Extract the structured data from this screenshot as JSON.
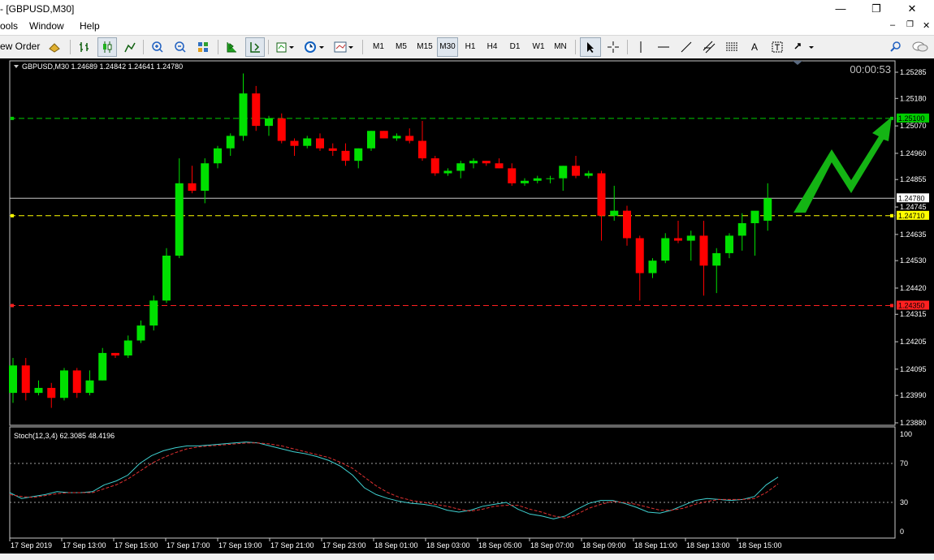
{
  "window": {
    "title": "- [GBPUSD,M30]",
    "controls": [
      "minimize-icon",
      "restore-icon",
      "close-icon"
    ]
  },
  "menu": {
    "items": [
      "ools",
      "Window",
      "Help"
    ],
    "mdi_controls": [
      "minimize-icon",
      "restore-icon",
      "close-icon"
    ]
  },
  "toolbar": {
    "new_order_label": "ew Order",
    "timeframes": [
      "M1",
      "M5",
      "M15",
      "M30",
      "H1",
      "H4",
      "D1",
      "W1",
      "MN"
    ],
    "selected_timeframe": "M30"
  },
  "chart": {
    "header": "GBPUSD,M30  1.24689 1.24842 1.24641 1.24780",
    "timer": "00:00:53",
    "stoch_header": "Stoch(12,3,4) 62.3085 48.4196"
  },
  "chart_data": [
    {
      "type": "candlestick",
      "symbol": "GBPUSD",
      "timeframe": "M30",
      "ylim": [
        1.2388,
        1.25285
      ],
      "yticks": [
        "1.25285",
        "1.25180",
        "1.25070",
        "1.24960",
        "1.24855",
        "1.24745",
        "1.24635",
        "1.24530",
        "1.24420",
        "1.24315",
        "1.24205",
        "1.24095",
        "1.23990",
        "1.23880"
      ],
      "xticks": [
        "17 Sep 2019",
        "17 Sep 13:00",
        "17 Sep 15:00",
        "17 Sep 17:00",
        "17 Sep 19:00",
        "17 Sep 21:00",
        "17 Sep 23:00",
        "18 Sep 01:00",
        "18 Sep 03:00",
        "18 Sep 05:00",
        "18 Sep 07:00",
        "18 Sep 09:00",
        "18 Sep 11:00",
        "18 Sep 13:00",
        "18 Sep 15:00"
      ],
      "bull_color": "#00e000",
      "bear_color": "#ff0000",
      "candles": [
        {
          "o": 1.24,
          "h": 1.2414,
          "l": 1.2396,
          "c": 1.2411
        },
        {
          "o": 1.2411,
          "h": 1.2414,
          "l": 1.2397,
          "c": 1.24
        },
        {
          "o": 1.24,
          "h": 1.2405,
          "l": 1.2399,
          "c": 1.2402
        },
        {
          "o": 1.2402,
          "h": 1.2404,
          "l": 1.2394,
          "c": 1.2398
        },
        {
          "o": 1.2398,
          "h": 1.241,
          "l": 1.2397,
          "c": 1.2409
        },
        {
          "o": 1.2409,
          "h": 1.241,
          "l": 1.2398,
          "c": 1.24
        },
        {
          "o": 1.24,
          "h": 1.2409,
          "l": 1.2399,
          "c": 1.2405
        },
        {
          "o": 1.2405,
          "h": 1.2418,
          "l": 1.2405,
          "c": 1.2416
        },
        {
          "o": 1.2416,
          "h": 1.2416,
          "l": 1.2414,
          "c": 1.2415
        },
        {
          "o": 1.2415,
          "h": 1.2423,
          "l": 1.2414,
          "c": 1.2421
        },
        {
          "o": 1.2421,
          "h": 1.2429,
          "l": 1.242,
          "c": 1.2427
        },
        {
          "o": 1.2427,
          "h": 1.2439,
          "l": 1.2425,
          "c": 1.2437
        },
        {
          "o": 1.2437,
          "h": 1.2458,
          "l": 1.2436,
          "c": 1.2455
        },
        {
          "o": 1.2455,
          "h": 1.2494,
          "l": 1.2454,
          "c": 1.2484
        },
        {
          "o": 1.2484,
          "h": 1.2491,
          "l": 1.248,
          "c": 1.2481
        },
        {
          "o": 1.2481,
          "h": 1.2494,
          "l": 1.2476,
          "c": 1.2492
        },
        {
          "o": 1.2492,
          "h": 1.2499,
          "l": 1.249,
          "c": 1.2498
        },
        {
          "o": 1.2498,
          "h": 1.2504,
          "l": 1.2495,
          "c": 1.2503
        },
        {
          "o": 1.2503,
          "h": 1.2528,
          "l": 1.2501,
          "c": 1.252
        },
        {
          "o": 1.252,
          "h": 1.2523,
          "l": 1.2505,
          "c": 1.2507
        },
        {
          "o": 1.2507,
          "h": 1.2511,
          "l": 1.2503,
          "c": 1.251
        },
        {
          "o": 1.251,
          "h": 1.2512,
          "l": 1.25,
          "c": 1.2501
        },
        {
          "o": 1.2501,
          "h": 1.2502,
          "l": 1.2495,
          "c": 1.2499
        },
        {
          "o": 1.2499,
          "h": 1.2503,
          "l": 1.2498,
          "c": 1.2502
        },
        {
          "o": 1.2502,
          "h": 1.2504,
          "l": 1.2497,
          "c": 1.2498
        },
        {
          "o": 1.2498,
          "h": 1.25,
          "l": 1.2495,
          "c": 1.2497
        },
        {
          "o": 1.2497,
          "h": 1.25,
          "l": 1.2491,
          "c": 1.2493
        },
        {
          "o": 1.2493,
          "h": 1.2498,
          "l": 1.249,
          "c": 1.2498
        },
        {
          "o": 1.2498,
          "h": 1.2505,
          "l": 1.2497,
          "c": 1.2505
        },
        {
          "o": 1.2505,
          "h": 1.2505,
          "l": 1.2502,
          "c": 1.2502
        },
        {
          "o": 1.2502,
          "h": 1.2504,
          "l": 1.2501,
          "c": 1.2503
        },
        {
          "o": 1.2503,
          "h": 1.2506,
          "l": 1.25,
          "c": 1.2501
        },
        {
          "o": 1.2501,
          "h": 1.2509,
          "l": 1.2493,
          "c": 1.2494
        },
        {
          "o": 1.2494,
          "h": 1.2495,
          "l": 1.2487,
          "c": 1.2488
        },
        {
          "o": 1.2488,
          "h": 1.249,
          "l": 1.2487,
          "c": 1.2489
        },
        {
          "o": 1.2489,
          "h": 1.2493,
          "l": 1.2486,
          "c": 1.2492
        },
        {
          "o": 1.2492,
          "h": 1.2494,
          "l": 1.249,
          "c": 1.2493
        },
        {
          "o": 1.2493,
          "h": 1.2493,
          "l": 1.2491,
          "c": 1.2492
        },
        {
          "o": 1.2492,
          "h": 1.2494,
          "l": 1.249,
          "c": 1.249
        },
        {
          "o": 1.249,
          "h": 1.2492,
          "l": 1.2483,
          "c": 1.2484
        },
        {
          "o": 1.2484,
          "h": 1.2486,
          "l": 1.2483,
          "c": 1.2485
        },
        {
          "o": 1.2485,
          "h": 1.2487,
          "l": 1.2484,
          "c": 1.2486
        },
        {
          "o": 1.2486,
          "h": 1.2487,
          "l": 1.2484,
          "c": 1.2486
        },
        {
          "o": 1.2486,
          "h": 1.2491,
          "l": 1.2481,
          "c": 1.2491
        },
        {
          "o": 1.2491,
          "h": 1.2495,
          "l": 1.2486,
          "c": 1.2487
        },
        {
          "o": 1.2487,
          "h": 1.2489,
          "l": 1.2486,
          "c": 1.2488
        },
        {
          "o": 1.2488,
          "h": 1.2489,
          "l": 1.2461,
          "c": 1.2471
        },
        {
          "o": 1.2471,
          "h": 1.2483,
          "l": 1.2469,
          "c": 1.2473
        },
        {
          "o": 1.2473,
          "h": 1.2475,
          "l": 1.2459,
          "c": 1.2462
        },
        {
          "o": 1.2462,
          "h": 1.2463,
          "l": 1.2437,
          "c": 1.2448
        },
        {
          "o": 1.2448,
          "h": 1.2454,
          "l": 1.2446,
          "c": 1.2453
        },
        {
          "o": 1.2453,
          "h": 1.2464,
          "l": 1.2452,
          "c": 1.2462
        },
        {
          "o": 1.2462,
          "h": 1.2469,
          "l": 1.246,
          "c": 1.2461
        },
        {
          "o": 1.2461,
          "h": 1.2465,
          "l": 1.2453,
          "c": 1.2463
        },
        {
          "o": 1.2463,
          "h": 1.2469,
          "l": 1.2439,
          "c": 1.2451
        },
        {
          "o": 1.2451,
          "h": 1.2458,
          "l": 1.244,
          "c": 1.2456
        },
        {
          "o": 1.2456,
          "h": 1.2464,
          "l": 1.2454,
          "c": 1.2463
        },
        {
          "o": 1.2463,
          "h": 1.2472,
          "l": 1.2457,
          "c": 1.2468
        },
        {
          "o": 1.2468,
          "h": 1.2472,
          "l": 1.2455,
          "c": 1.2473
        },
        {
          "o": 1.2469,
          "h": 1.2484,
          "l": 1.2465,
          "c": 1.2478
        }
      ],
      "levels": [
        {
          "value": 1.251,
          "label": "1.25100",
          "color": "#00cc00"
        },
        {
          "value": 1.2478,
          "label": "1.24780",
          "color": "#c8c8c8"
        },
        {
          "value": 1.2471,
          "label": "1.24710",
          "color": "#ffff00"
        },
        {
          "value": 1.2435,
          "label": "1.24350",
          "color": "#ff2020"
        }
      ]
    },
    {
      "type": "line",
      "name": "Stoch(12,3,4)",
      "ylim": [
        0,
        100
      ],
      "yticks": [
        "100",
        "70",
        "30",
        "0"
      ],
      "levels": [
        70,
        30
      ],
      "series": [
        {
          "color": "#3fd0d0",
          "values": [
            40,
            34,
            36,
            38,
            41,
            40,
            40,
            41,
            48,
            52,
            58,
            70,
            78,
            83,
            86,
            88,
            88,
            89,
            90,
            91,
            92,
            91,
            88,
            85,
            82,
            80,
            77,
            73,
            67,
            58,
            45,
            38,
            34,
            31,
            29,
            28,
            26,
            22,
            20,
            22,
            26,
            28,
            30,
            23,
            18,
            16,
            13,
            16,
            23,
            29,
            32,
            32,
            29,
            25,
            20,
            19,
            22,
            27,
            32,
            34,
            33,
            32,
            33,
            36,
            48,
            56
          ]
        },
        {
          "color": "#e03030",
          "dashed": true,
          "values": [
            38,
            36,
            35,
            37,
            39,
            40,
            40,
            40,
            44,
            48,
            54,
            62,
            70,
            76,
            81,
            85,
            87,
            88,
            89,
            90,
            91,
            91,
            90,
            88,
            85,
            82,
            79,
            76,
            71,
            65,
            56,
            47,
            40,
            35,
            32,
            30,
            28,
            26,
            23,
            21,
            23,
            26,
            27,
            27,
            23,
            20,
            16,
            14,
            18,
            24,
            28,
            31,
            30,
            28,
            25,
            22,
            22,
            24,
            28,
            31,
            33,
            33,
            33,
            34,
            40,
            49
          ]
        }
      ]
    }
  ]
}
